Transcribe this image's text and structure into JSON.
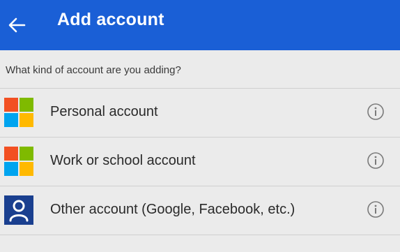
{
  "header": {
    "title": "Add account",
    "color": "#1a5fd6"
  },
  "prompt": "What kind of account are you adding?",
  "accounts": [
    {
      "label": "Personal account",
      "icon": "microsoft-logo-icon"
    },
    {
      "label": "Work or school account",
      "icon": "microsoft-logo-icon"
    },
    {
      "label": "Other account (Google, Facebook, etc.)",
      "icon": "person-icon"
    }
  ],
  "colors": {
    "ms_red": "#f25022",
    "ms_green": "#7fba00",
    "ms_blue": "#00a4ef",
    "ms_yellow": "#ffb900",
    "person_bg": "#1a3f8f"
  }
}
